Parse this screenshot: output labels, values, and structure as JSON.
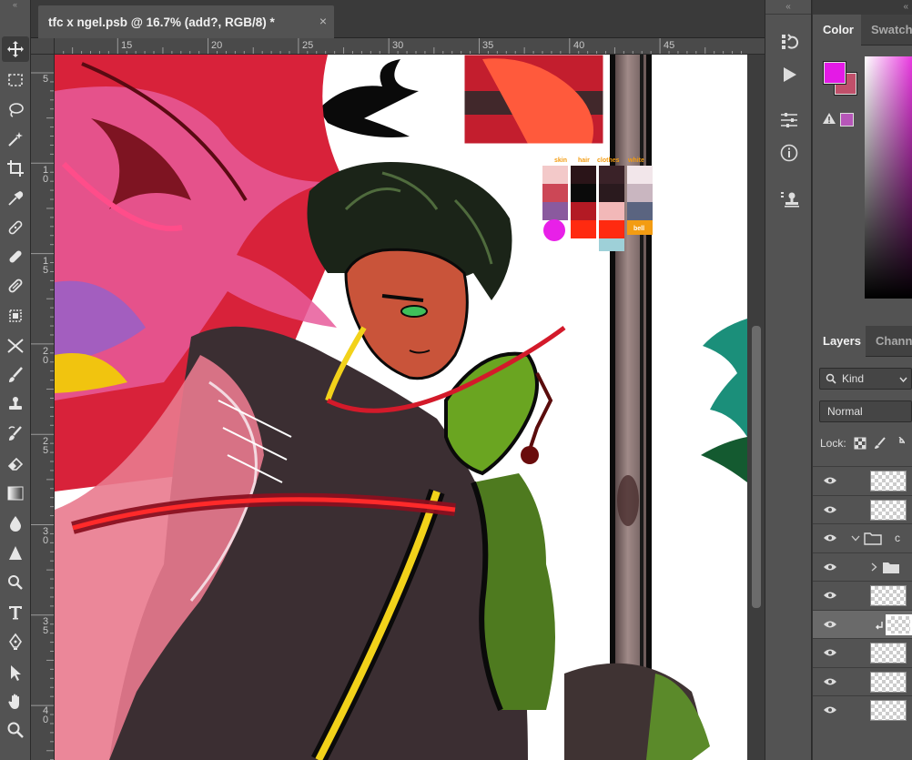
{
  "document": {
    "tab_title": "tfc x ngel.psb @ 16.7% (add?, RGB/8) *",
    "close_glyph": "×"
  },
  "rulers": {
    "horizontal": [
      "15",
      "20",
      "25",
      "30",
      "35",
      "40",
      "45"
    ],
    "vertical": [
      "5",
      "1 0",
      "1 5",
      "2 0",
      "2 5",
      "3 0",
      "3 5",
      "4 0"
    ]
  },
  "toolbar": {
    "tools": [
      "move-tool",
      "marquee-tool",
      "lasso-tool",
      "magic-wand-tool",
      "crop-tool",
      "eyedropper-tool",
      "spot-healing-tool",
      "healing-tool",
      "patch-tool",
      "content-aware-move-tool",
      "red-eye-tool",
      "brush-tool",
      "clone-stamp-tool",
      "history-brush-tool",
      "eraser-tool",
      "gradient-tool",
      "blur-tool",
      "sharpen-tool",
      "dodge-tool",
      "type-tool",
      "pen-tool",
      "path-selection-tool",
      "hand-tool",
      "zoom-tool"
    ]
  },
  "canvas": {
    "palette_labels": [
      "skin",
      "hair",
      "clothes",
      "white"
    ],
    "bell_label": "bell"
  },
  "panel_strip": {
    "icons": [
      "history-icon",
      "actions-play-icon",
      "adjustments-icon",
      "info-icon",
      "stamp-icon"
    ]
  },
  "color_panel": {
    "tabs": [
      "Color",
      "Swatches"
    ],
    "foreground": "#e41ae6",
    "background": "#c0506a"
  },
  "layers_panel": {
    "tabs": [
      "Layers",
      "Channels"
    ],
    "filter_label": "Kind",
    "blend_mode": "Normal",
    "lock_label": "Lock:",
    "group_name": "c"
  },
  "grip_glyph": "«"
}
